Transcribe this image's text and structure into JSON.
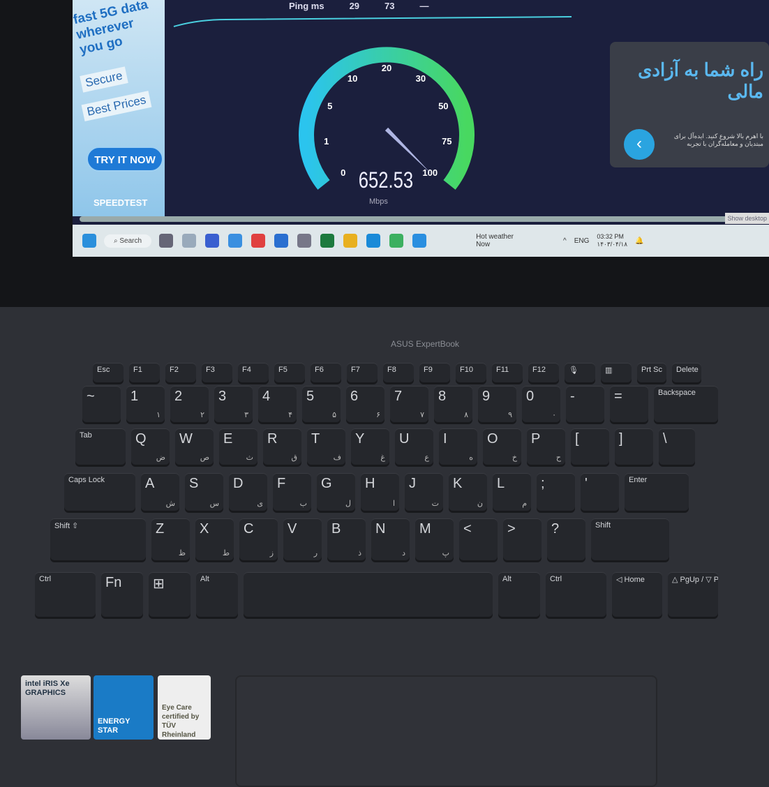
{
  "ad": {
    "headline": "fast 5G data wherever you go",
    "tag1": "Secure",
    "tag2": "Best Prices",
    "cta": "TRY IT NOW",
    "brand": "SPEEDTEST"
  },
  "speedtest": {
    "ping_label": "Ping ms",
    "ping_idle": "29",
    "ping_down": "73",
    "ping_up": "—",
    "ticks": [
      "0",
      "1",
      "5",
      "10",
      "20",
      "30",
      "50",
      "75",
      "100"
    ],
    "value": "652.53",
    "unit": "Mbps",
    "needle_value": 100,
    "colors": {
      "arc_start": "#2bc4ee",
      "arc_end": "#48d860",
      "bg": "#1b1f3d"
    }
  },
  "side_ad": {
    "title": "راه شما به آزادی مالی",
    "body": "با اهرم بالا شروع کنید. ایده‌آل برای مبتدیان و معامله‌گران با تجربه",
    "arrow": "‹"
  },
  "taskbar": {
    "search": "Search",
    "weather_title": "Hot weather",
    "weather_sub": "Now",
    "lang": "ENG",
    "time": "03:32 PM",
    "date": "۱۴۰۳/۰۴/۱۸",
    "show_desktop": "Show desktop",
    "icons": [
      "settings-icon",
      "photos-icon",
      "app-icon",
      "feedback-icon",
      "maps-icon",
      "store-icon",
      "camera-icon",
      "excel-icon",
      "chrome-icon",
      "edge-icon",
      "clock-icon",
      "bluetooth-icon"
    ]
  },
  "laptop": {
    "brand": "ASUS ExpertBook"
  },
  "keyboard": {
    "rows": [
      [
        "Esc",
        "F1",
        "F2",
        "F3",
        "F4",
        "F5",
        "F6",
        "F7",
        "F8",
        "F9",
        "F10",
        "F11",
        "F12",
        "🎙",
        "▥",
        "Prt Sc",
        "Delete"
      ],
      [
        "~",
        "1",
        "2",
        "3",
        "4",
        "5",
        "6",
        "7",
        "8",
        "9",
        "0",
        "-",
        "=",
        "Backspace"
      ],
      [
        "Tab",
        "Q",
        "W",
        "E",
        "R",
        "T",
        "Y",
        "U",
        "I",
        "O",
        "P",
        "[",
        "]",
        "\\"
      ],
      [
        "Caps Lock",
        "A",
        "S",
        "D",
        "F",
        "G",
        "H",
        "J",
        "K",
        "L",
        ";",
        "'",
        "Enter"
      ],
      [
        "Shift ⇧",
        "Z",
        "X",
        "C",
        "V",
        "B",
        "N",
        "M",
        "<",
        ">",
        "?",
        "Shift"
      ],
      [
        "Ctrl",
        "Fn",
        "⊞",
        "Alt",
        "",
        "Alt",
        "Ctrl",
        "◁ Home",
        "△ PgUp / ▽ PgDn"
      ]
    ],
    "persian": {
      "Q": "ض",
      "W": "ص",
      "E": "ث",
      "R": "ق",
      "T": "ف",
      "Y": "غ",
      "U": "ع",
      "I": "ه",
      "O": "خ",
      "P": "ح",
      "A": "ش",
      "S": "س",
      "D": "ی",
      "F": "ب",
      "G": "ل",
      "H": "ا",
      "J": "ت",
      "K": "ن",
      "L": "م",
      "Z": "ظ",
      "X": "ط",
      "C": "ز",
      "V": "ر",
      "B": "ذ",
      "N": "د",
      "M": "پ",
      "1": "۱",
      "2": "۲",
      "3": "۳",
      "4": "۴",
      "5": "۵",
      "6": "۶",
      "7": "۷",
      "8": "۸",
      "9": "۹",
      "0": "۰"
    }
  },
  "stickers": {
    "intel": "intel iRIS Xe GRAPHICS",
    "energy": "ENERGY STAR",
    "eye": "Eye Care certified by TÜV Rheinland"
  }
}
